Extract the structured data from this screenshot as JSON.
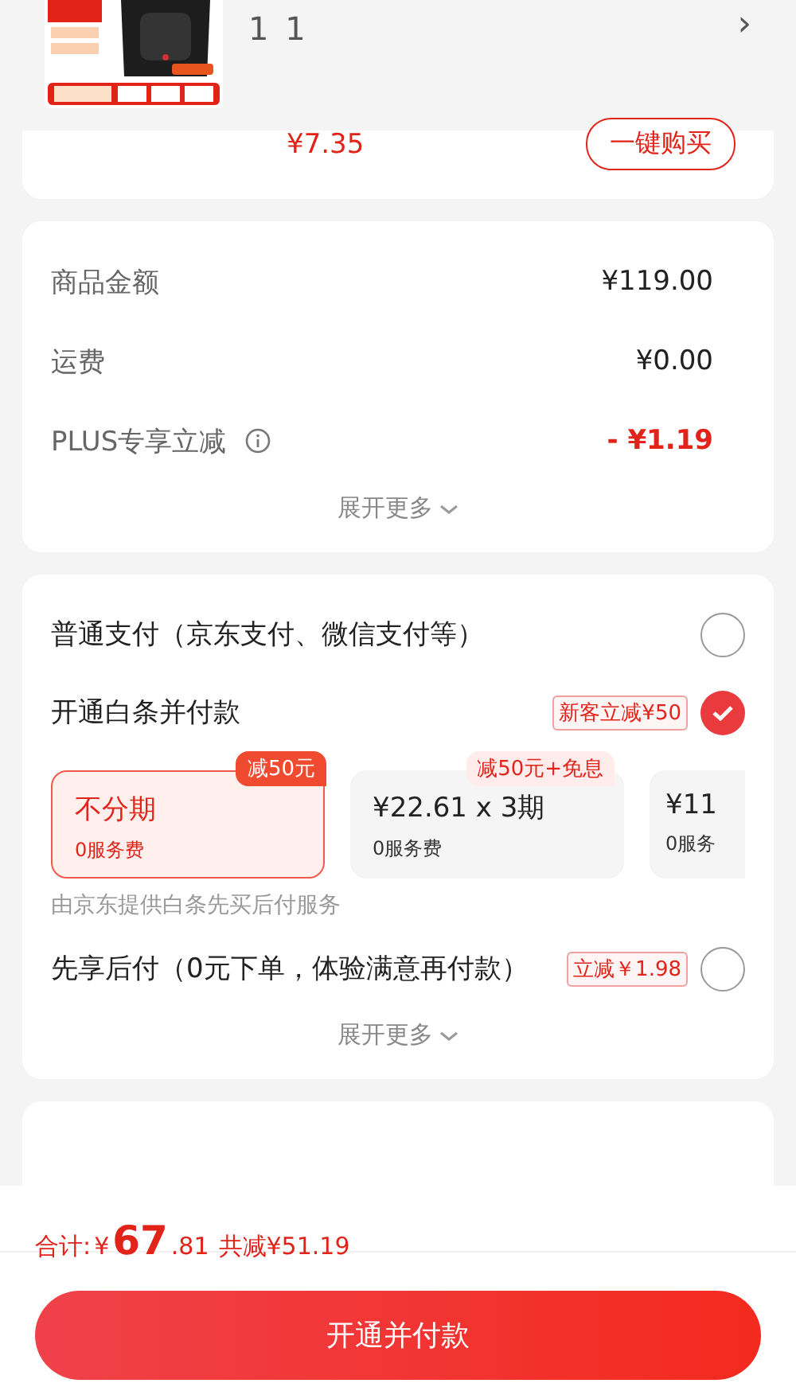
{
  "header": {
    "quantity": "1 1",
    "chevron": "›"
  },
  "partial_card": {
    "price": "¥7.35",
    "button": "一键购买"
  },
  "summary": {
    "rows": [
      {
        "label": "商品金额",
        "value": "¥119.00",
        "kind": "plain"
      },
      {
        "label": "运费",
        "value": "¥0.00",
        "kind": "plain"
      },
      {
        "label": "PLUS专享立减",
        "value": "- ¥1.19",
        "kind": "discount",
        "info": true
      }
    ],
    "expand": "展开更多"
  },
  "payment": {
    "methods": [
      {
        "label": "普通支付（京东支付、微信支付等）",
        "selected": false
      },
      {
        "label": "开通白条并付款",
        "tag": "新客立减¥50",
        "selected": true,
        "plans": [
          {
            "title": "不分期",
            "fee": "0服务费",
            "badge": "减50元",
            "selected": true
          },
          {
            "title": "¥22.61 x 3期",
            "fee": "0服务费",
            "badge": "减50元+免息",
            "selected": false
          },
          {
            "title": "¥11",
            "fee": "0服务",
            "selected": false
          }
        ],
        "note": "由京东提供白条先买后付服务"
      },
      {
        "label": "先享后付（0元下单，体验满意再付款）",
        "tag": "立减￥1.98",
        "selected": false
      }
    ],
    "expand": "展开更多"
  },
  "footer": {
    "total_label": "合计:",
    "currency": "¥",
    "integer": "67",
    "decimal": ".81",
    "saved": "共减¥51.19",
    "button": "开通并付款"
  }
}
